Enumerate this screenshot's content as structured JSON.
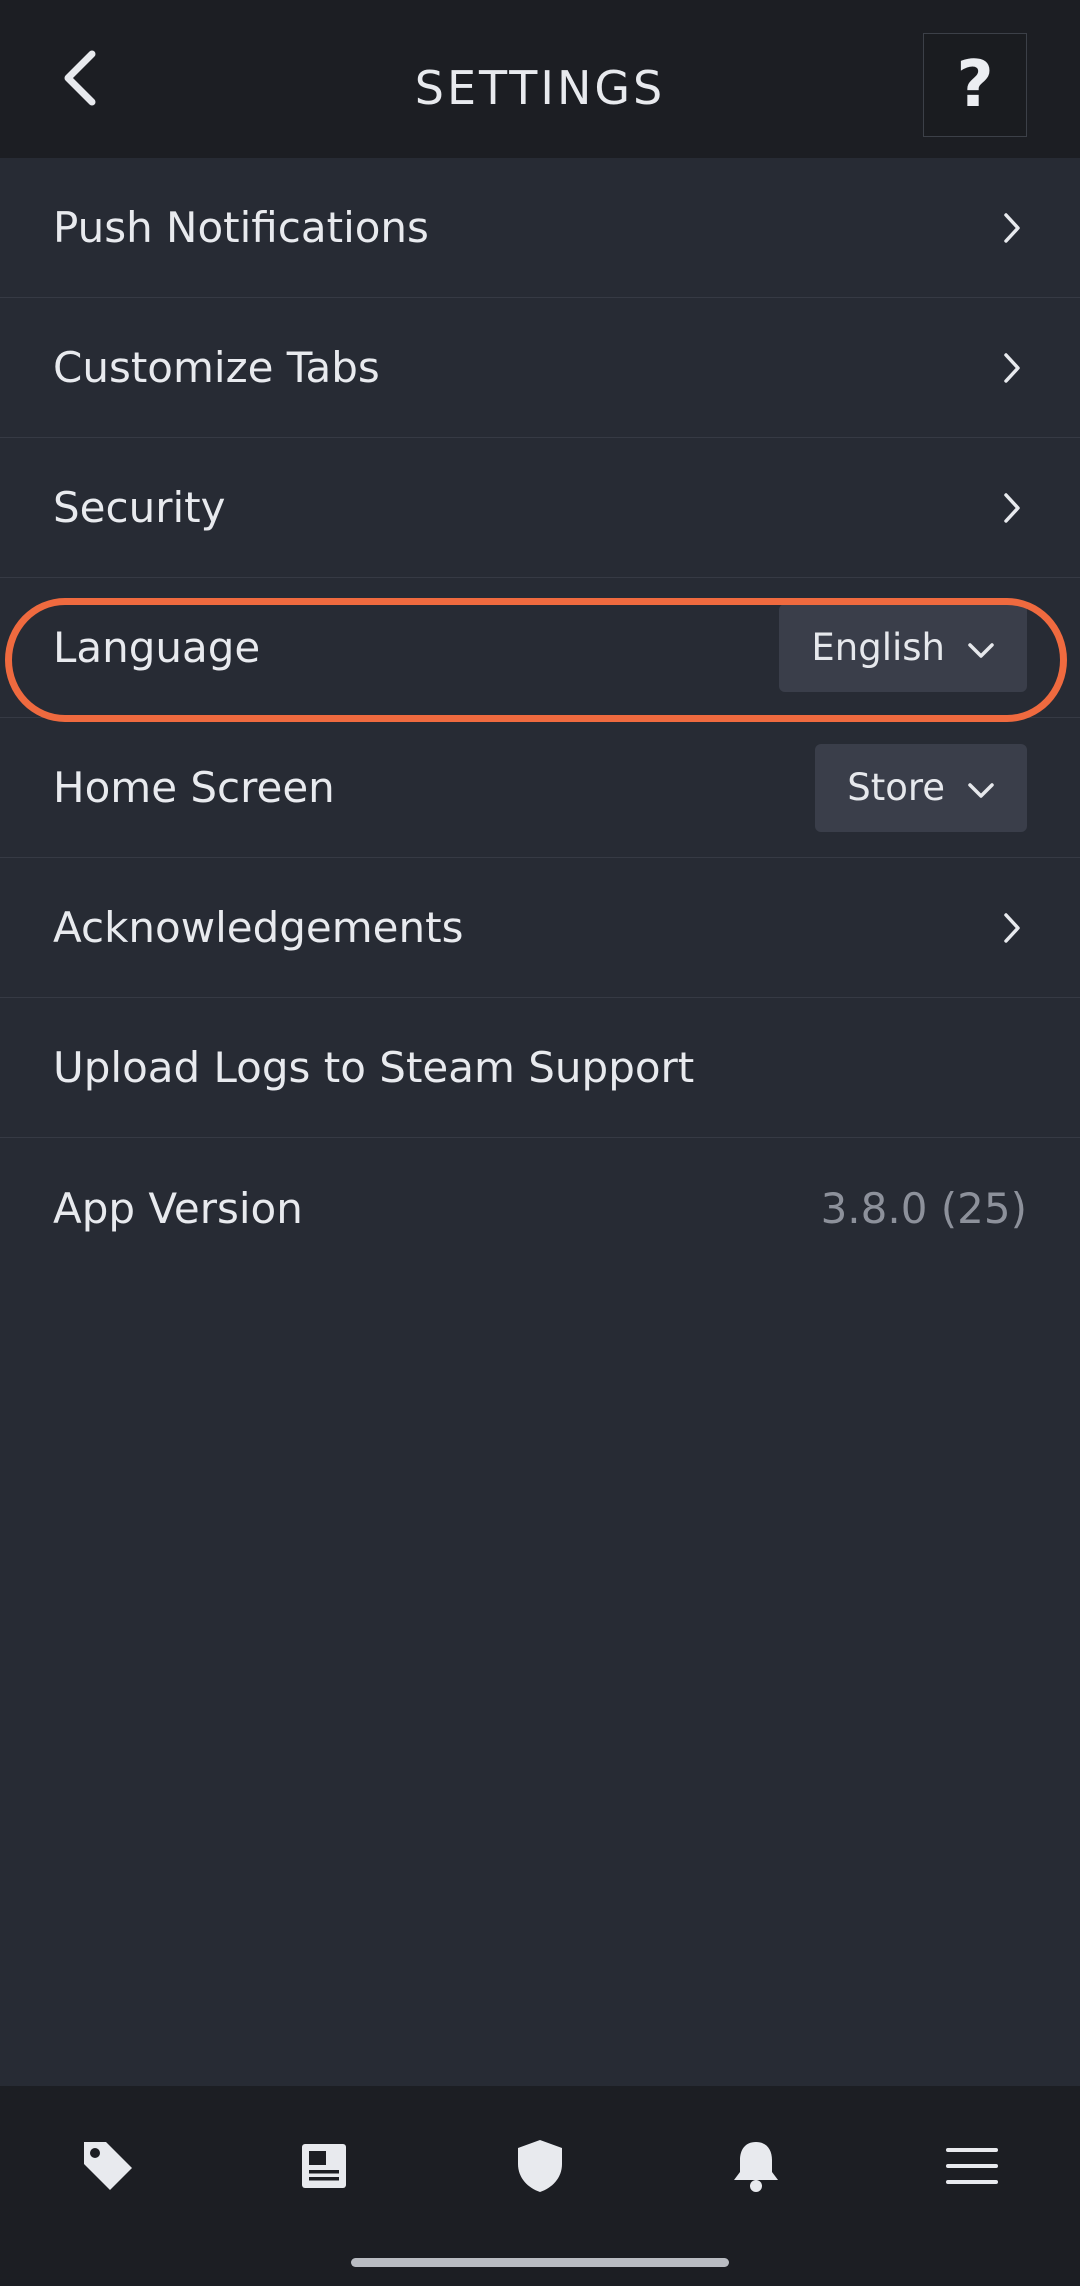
{
  "header": {
    "title": "SETTINGS",
    "help_label": "?",
    "back_icon": "chevron-left-icon"
  },
  "settings": {
    "push_notifications": {
      "label": "Push Notifications"
    },
    "customize_tabs": {
      "label": "Customize Tabs"
    },
    "security": {
      "label": "Security"
    },
    "language": {
      "label": "Language",
      "value": "English"
    },
    "home_screen": {
      "label": "Home Screen",
      "value": "Store"
    },
    "acknowledgements": {
      "label": "Acknowledgements"
    },
    "upload_logs": {
      "label": "Upload Logs to Steam Support"
    },
    "app_version": {
      "label": "App Version",
      "value": "3.8.0 (25)"
    }
  },
  "bottom_nav": {
    "items": [
      {
        "icon": "tag-icon",
        "name": "store"
      },
      {
        "icon": "news-icon",
        "name": "news"
      },
      {
        "icon": "shield-icon",
        "name": "guard"
      },
      {
        "icon": "bell-icon",
        "name": "notifications"
      },
      {
        "icon": "menu-icon",
        "name": "menu"
      }
    ]
  },
  "colors": {
    "background": "#272b34",
    "header": "#1c1e23",
    "highlight": "#ef6a3f",
    "dropdown": "#3a3e4a"
  }
}
